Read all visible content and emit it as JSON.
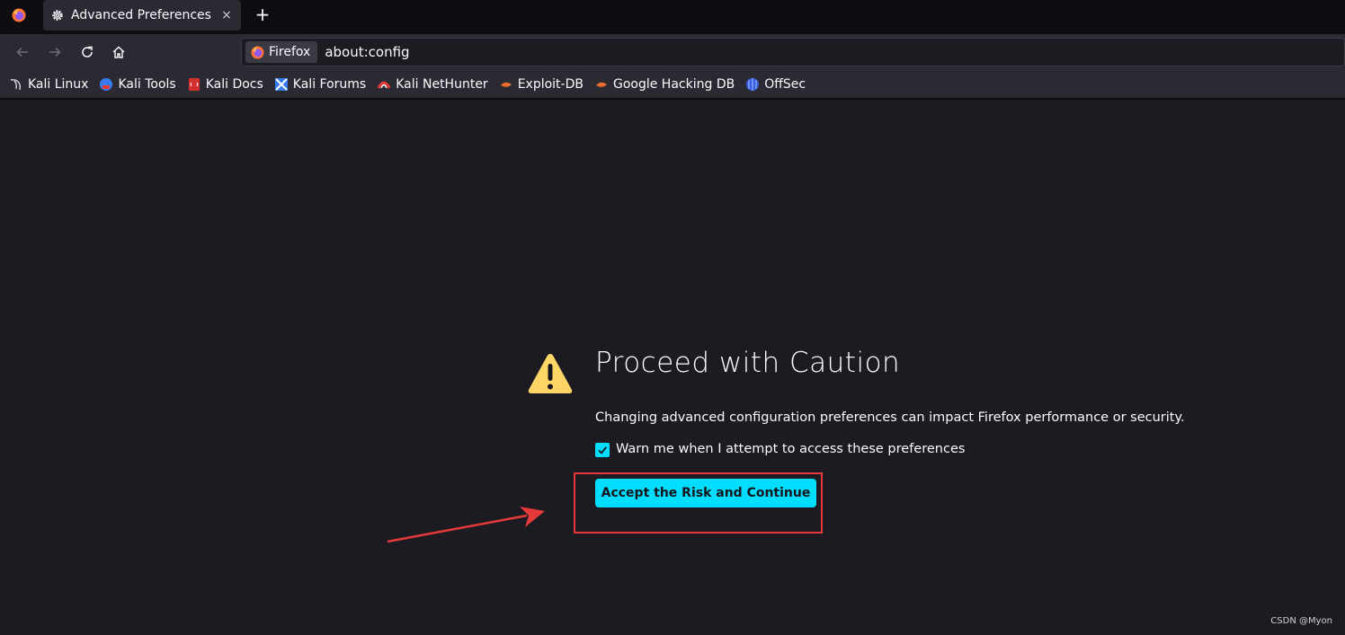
{
  "tab": {
    "title": "Advanced Preferences",
    "close": "×",
    "new_tab": "+"
  },
  "urlbar": {
    "identity_label": "Firefox",
    "url": "about:config"
  },
  "bookmarks": [
    {
      "label": "Kali Linux",
      "icon": "kali-dragon-icon"
    },
    {
      "label": "Kali Tools",
      "icon": "kali-tools-icon"
    },
    {
      "label": "Kali Docs",
      "icon": "kali-docs-icon"
    },
    {
      "label": "Kali Forums",
      "icon": "kali-forums-icon"
    },
    {
      "label": "Kali NetHunter",
      "icon": "kali-nethunter-icon"
    },
    {
      "label": "Exploit-DB",
      "icon": "exploit-db-icon"
    },
    {
      "label": "Google Hacking DB",
      "icon": "ghdb-icon"
    },
    {
      "label": "OffSec",
      "icon": "offsec-icon"
    }
  ],
  "warning": {
    "title": "Proceed with Caution",
    "description": "Changing advanced configuration preferences can impact Firefox performance or security.",
    "checkbox_label": "Warn me when I attempt to access these preferences",
    "checkbox_checked": true,
    "accept_button": "Accept the Risk and Continue"
  },
  "watermark": "CSDN @Myon⁠",
  "colors": {
    "accent": "#00ddff",
    "annotation": "#e5393a",
    "warning_icon": "#ffd567"
  }
}
